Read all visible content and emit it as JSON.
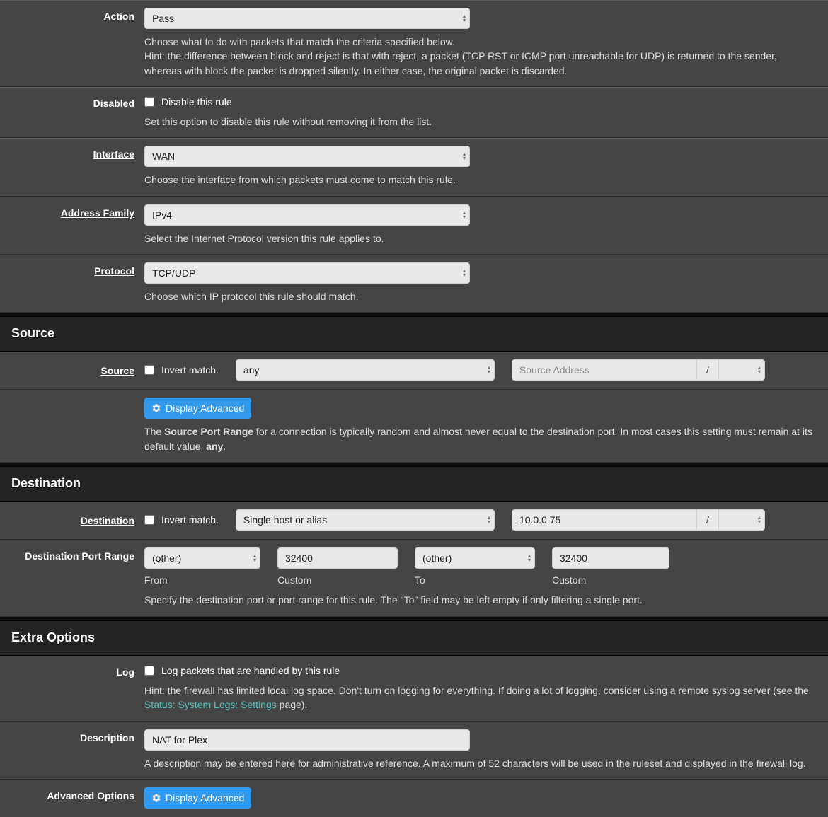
{
  "labels": {
    "action": "Action",
    "disabled": "Disabled",
    "interface": "Interface",
    "address_family": "Address Family",
    "protocol": "Protocol",
    "source": "Source",
    "destination": "Destination",
    "dest_port_range": "Destination Port Range",
    "log": "Log",
    "description": "Description",
    "advanced_options": "Advanced Options"
  },
  "section": {
    "source": "Source",
    "destination": "Destination",
    "extra": "Extra Options"
  },
  "action": {
    "value": "Pass",
    "help": "Choose what to do with packets that match the criteria specified below.\nHint: the difference between block and reject is that with reject, a packet (TCP RST or ICMP port unreachable for UDP) is returned to the sender, whereas with block the packet is dropped silently. In either case, the original packet is discarded."
  },
  "disabled": {
    "checkbox_label": "Disable this rule",
    "help": "Set this option to disable this rule without removing it from the list."
  },
  "interface": {
    "value": "WAN",
    "help": "Choose the interface from which packets must come to match this rule."
  },
  "address_family": {
    "value": "IPv4",
    "help": "Select the Internet Protocol version this rule applies to."
  },
  "protocol": {
    "value": "TCP/UDP",
    "help": "Choose which IP protocol this rule should match."
  },
  "source": {
    "invert_label": "Invert match.",
    "type_value": "any",
    "addr_placeholder": "Source Address",
    "cidr_placeholder": "",
    "display_advanced": "Display Advanced",
    "help_prefix": "The ",
    "help_bold": "Source Port Range",
    "help_mid": " for a connection is typically random and almost never equal to the destination port. In most cases this setting must remain at its default value, ",
    "help_bold2": "any",
    "help_suffix": "."
  },
  "destination": {
    "invert_label": "Invert match.",
    "type_value": "Single host or alias",
    "addr_value": "10.0.0.75",
    "slash": "/",
    "port": {
      "from_select": "(other)",
      "from_custom": "32400",
      "to_select": "(other)",
      "to_custom": "32400",
      "sub_from": "From",
      "sub_custom1": "Custom",
      "sub_to": "To",
      "sub_custom2": "Custom"
    },
    "help": "Specify the destination port or port range for this rule. The \"To\" field may be left empty if only filtering a single port."
  },
  "extra": {
    "log_checkbox_label": "Log packets that are handled by this rule",
    "log_help_prefix": "Hint: the firewall has limited local log space. Don't turn on logging for everything. If doing a lot of logging, consider using a remote syslog server (see the ",
    "log_link_text": "Status: System Logs: Settings",
    "log_help_suffix": " page).",
    "description_value": "NAT for Plex",
    "description_help": "A description may be entered here for administrative reference. A maximum of 52 characters will be used in the ruleset and displayed in the firewall log.",
    "display_advanced": "Display Advanced"
  },
  "slash": "/"
}
